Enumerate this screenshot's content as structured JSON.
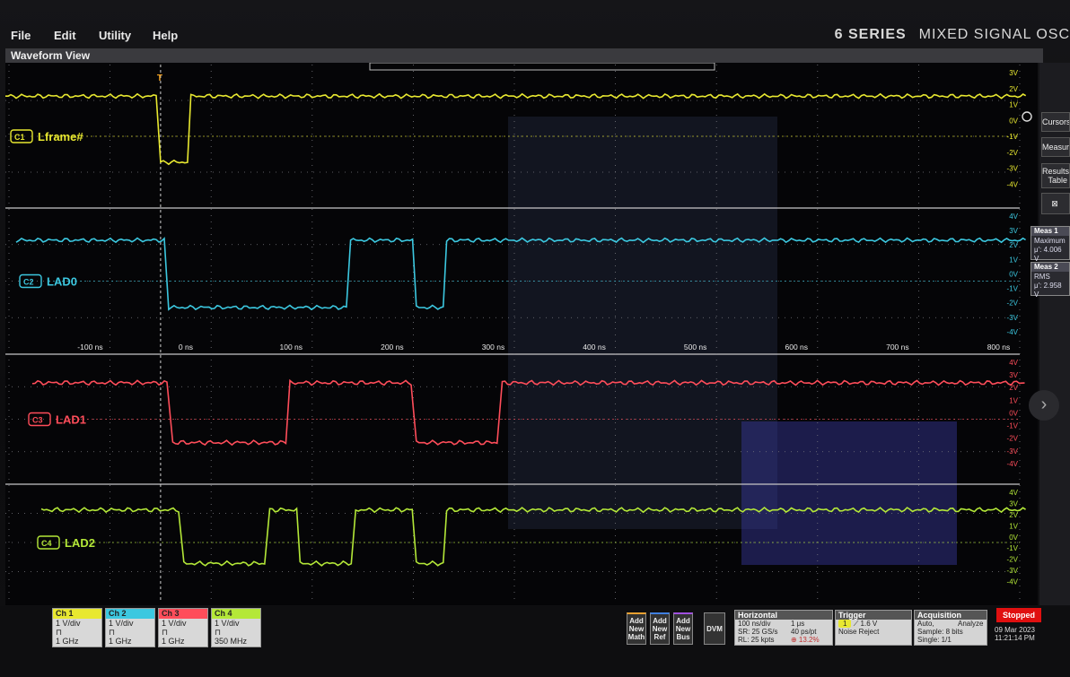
{
  "menu": [
    "File",
    "Edit",
    "Utility",
    "Help"
  ],
  "brand": {
    "series": "6 SERIES",
    "product": "MIXED SIGNAL OSC"
  },
  "waveform_view": {
    "title": "Waveform View"
  },
  "trigger_marker": "T",
  "time_axis": [
    "-100 ns",
    "0 ns",
    "100 ns",
    "200 ns",
    "300 ns",
    "400 ns",
    "500 ns",
    "600 ns",
    "700 ns",
    "800 ns"
  ],
  "channels": [
    {
      "id": "C1",
      "label": "Lframe#",
      "color": "#e8e830",
      "scale": [
        "3V",
        "2V",
        "1V",
        "0V",
        "-1V",
        "-2V",
        "-3V",
        "-4V"
      ]
    },
    {
      "id": "C2",
      "label": "LAD0",
      "color": "#3cc8e0",
      "scale": [
        "4V",
        "3V",
        "2V",
        "1V",
        "0V",
        "-1V",
        "-2V",
        "-3V",
        "-4V"
      ]
    },
    {
      "id": "C3",
      "label": "LAD1",
      "color": "#ff4d5a",
      "scale": [
        "4V",
        "3V",
        "2V",
        "1V",
        "0V",
        "-1V",
        "-2V",
        "-3V",
        "-4V"
      ]
    },
    {
      "id": "C4",
      "label": "LAD2",
      "color": "#b4e838",
      "scale": [
        "4V",
        "3V",
        "2V",
        "1V",
        "0V",
        "-1V",
        "-2V",
        "-3V",
        "-4V"
      ]
    }
  ],
  "right_panel": {
    "cursors": "Cursors",
    "measure": "Measure",
    "results_table_1": "Results",
    "results_table_2": "Table"
  },
  "meas1": {
    "title": "Meas 1",
    "name": "Maximum",
    "value": "μ': 4.006 V"
  },
  "meas2": {
    "title": "Meas 2",
    "name": "RMS",
    "value": "μ': 2.958 V"
  },
  "ch_badges": [
    {
      "name": "Ch 1",
      "scale": "1 V/div",
      "bw": "1 GHz",
      "color": "#e8e830"
    },
    {
      "name": "Ch 2",
      "scale": "1 V/div",
      "bw": "1 GHz",
      "color": "#3cc8e0"
    },
    {
      "name": "Ch 3",
      "scale": "1 V/div",
      "bw": "1 GHz",
      "color": "#ff4d5a"
    },
    {
      "name": "Ch 4",
      "scale": "1 V/div",
      "bw": "350 MHz",
      "color": "#b4e838"
    }
  ],
  "add_buttons": [
    {
      "l1": "Add",
      "l2": "New",
      "l3": "Math"
    },
    {
      "l1": "Add",
      "l2": "New",
      "l3": "Ref"
    },
    {
      "l1": "Add",
      "l2": "New",
      "l3": "Bus"
    }
  ],
  "dvm": "DVM",
  "horizontal": {
    "title": "Horizontal",
    "scale": "100 ns/div",
    "duration": "1 μs",
    "sr": "SR: 25 GS/s",
    "ps": "40 ps/pt",
    "rl": "RL: 25 kpts",
    "pct": "⊕ 13.2%"
  },
  "trigger": {
    "title": "Trigger",
    "level": "1.6 V",
    "mode": "Noise Reject",
    "channel": "1"
  },
  "acquisition": {
    "title": "Acquisition",
    "mode": "Auto,",
    "analyze": "Analyze",
    "sample": "Sample: 8 bits",
    "single": "Single: 1/1"
  },
  "status": "Stopped",
  "date": "09 Mar 2023",
  "time": "11:21:14 PM"
}
